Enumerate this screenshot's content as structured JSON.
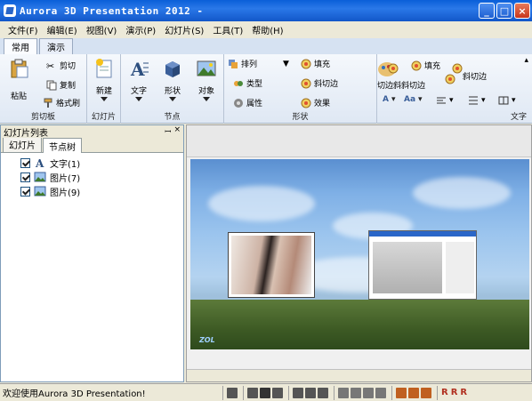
{
  "window": {
    "title": "Aurora 3D Presentation 2012 -",
    "controls": {
      "minimize": "_",
      "maximize": "□",
      "close": "×"
    }
  },
  "menu": [
    "文件(F)",
    "编辑(E)",
    "视图(V)",
    "演示(P)",
    "幻灯片(S)",
    "工具(T)",
    "帮助(H)"
  ],
  "ribbon_tabs": [
    {
      "label": "常用",
      "active": true
    },
    {
      "label": "演示",
      "active": false
    }
  ],
  "ribbon": {
    "clipboard": {
      "label": "剪切板",
      "paste": "粘贴",
      "cut": "剪切",
      "copy": "复制",
      "format_painter": "格式刷"
    },
    "slides": {
      "label": "幻灯片",
      "new": "新建"
    },
    "nodes": {
      "label": "节点",
      "text": "文字",
      "shape": "形状",
      "object": "对象"
    },
    "shapes": {
      "label": "形状",
      "arrange": "排列",
      "type": "类型",
      "properties": "属性",
      "fill": "填充",
      "bevel": "斜切边",
      "effect": "效果"
    },
    "text_group": {
      "label": "文字",
      "fill": "填充",
      "bevel": "斜切边",
      "overlay": "切边斜斜切边",
      "style_a": "A",
      "style_ab": "Aa"
    }
  },
  "left_panel": {
    "title": "幻灯片列表",
    "pin": "ꟷ",
    "close": "×",
    "tabs": [
      {
        "label": "幻灯片",
        "active": false
      },
      {
        "label": "节点树",
        "active": true
      }
    ],
    "tree": [
      {
        "label": "文字(1)",
        "icon": "text-icon"
      },
      {
        "label": "图片(7)",
        "icon": "image-icon"
      },
      {
        "label": "图片(9)",
        "icon": "image-icon"
      }
    ]
  },
  "canvas": {
    "watermark": "ZOL"
  },
  "status": {
    "message": "欢迎使用Aurora 3D Presentation!",
    "r_buttons": [
      "R",
      "R",
      "R"
    ]
  },
  "colors": {
    "titlebar": "#1257c9",
    "ribbon": "#dfe8f4",
    "chrome": "#ece9d8"
  }
}
